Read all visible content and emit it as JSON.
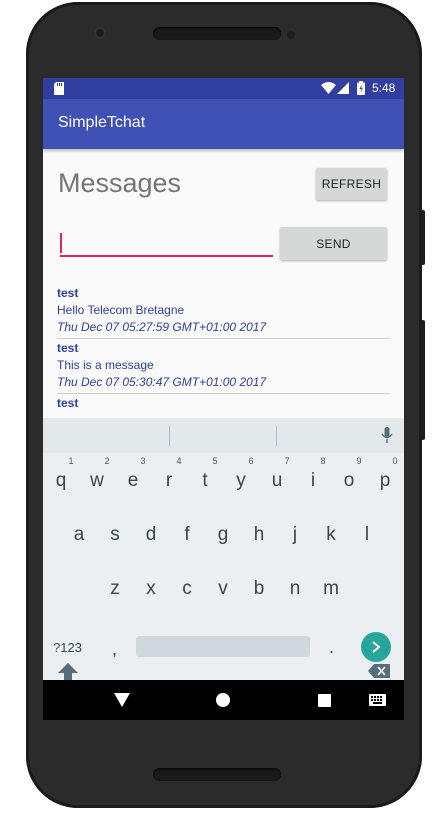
{
  "status_bar": {
    "time": "5:48"
  },
  "app_bar": {
    "title": "SimpleTchat"
  },
  "main": {
    "heading": "Messages",
    "refresh_label": "REFRESH",
    "send_label": "SEND",
    "input_value": ""
  },
  "messages": [
    {
      "author": "test",
      "text": "Hello Telecom Bretagne",
      "time": "Thu Dec 07 05:27:59 GMT+01:00 2017"
    },
    {
      "author": "test",
      "text": "This is a message",
      "time": "Thu Dec 07 05:30:47 GMT+01:00 2017"
    },
    {
      "author": "test"
    }
  ],
  "keyboard": {
    "row1": [
      "q",
      "w",
      "e",
      "r",
      "t",
      "y",
      "u",
      "i",
      "o",
      "p"
    ],
    "row1_hints": [
      "1",
      "2",
      "3",
      "4",
      "5",
      "6",
      "7",
      "8",
      "9",
      "0"
    ],
    "row2": [
      "a",
      "s",
      "d",
      "f",
      "g",
      "h",
      "j",
      "k",
      "l"
    ],
    "row3": [
      "z",
      "x",
      "c",
      "v",
      "b",
      "n",
      "m"
    ],
    "symbols_label": "?123",
    "comma": ",",
    "period": ".",
    "icons": [
      "mic-icon",
      "shift-icon",
      "backspace-icon",
      "enter-icon"
    ]
  },
  "nav_icons": [
    "back-icon",
    "home-icon",
    "recents-icon",
    "keyboard-switch-icon"
  ],
  "colors": {
    "primary": "#3f51b5",
    "primary_dark": "#303f9f",
    "accent": "#e91e63",
    "enter_key": "#26a69a"
  }
}
